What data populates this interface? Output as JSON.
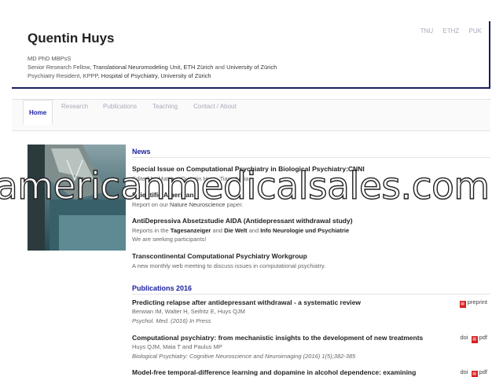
{
  "header": {
    "name": "Quentin Huys",
    "degrees": "MD PhD MBPsS",
    "line2_a": "Senior Research Fellow,",
    "line2_b": "Translational Neuromodeling Unit, ETH Zürich",
    "line2_c": "and",
    "line2_d": "University of Zürich",
    "line3_a": "Psychiatry Resident, KPPP,",
    "line3_b": "Hospital of Psychiatry, University of Zürich",
    "links": [
      "TNU",
      "ETHZ",
      "PUK"
    ]
  },
  "nav": {
    "tabs": [
      "Home",
      "Research",
      "Publications",
      "Teaching",
      "Contact / About"
    ]
  },
  "news": {
    "heading": "News",
    "items": [
      {
        "title": "Special Issue on Computational Psychiatry in Biological Psychiatry:CNNI",
        "text": "Edited by Mattia... Quentin Huys, Tiago Maia"
      },
      {
        "title": "Scientific American",
        "text_a": "Report on our",
        "text_b": "Nature Neuroscience",
        "text_c": "paper."
      },
      {
        "title": "AntiDepressiva Absetzstudie AIDA (Antidepressant withdrawal study)",
        "text_a": "Reports in the",
        "text_b": "Tagesanzeiger",
        "text_c": "and",
        "text_d": "Die Welt",
        "text_e": "and",
        "text_f": "Info Neurologie und Psychiatrie",
        "text2": "We are seeking participants!"
      },
      {
        "title": "Transcontinental Computational Psychiatry Workgroup",
        "text": "A new monthly web meeting to discuss issues in computational psychiatry."
      }
    ]
  },
  "pubs": {
    "heading": "Publications 2016",
    "items": [
      {
        "title": "Predicting relapse after antidepressant withdrawal - a systematic review",
        "authors": "Berwian IM, Walter H, Seifritz E, Huys QJM",
        "journal": "Psychol. Med. (2016) In Press",
        "link": "preprint"
      },
      {
        "title": "Computational psychiatry: from mechanistic insights to the development of new treatments",
        "authors": "Huys QJM, Maia T and Paulus MP",
        "journal": "Biological Psychiatry: Cognitive Neuroscience and Neuroimaging (2016) 1(5);382-385",
        "link_a": "doi",
        "link_b": "pdf"
      },
      {
        "title": "Model-free temporal-difference learning and dopamine in alcohol dependence: examining",
        "link_a": "doi",
        "link_b": "pdf"
      }
    ]
  },
  "watermark": "americanmedicalsales.com"
}
